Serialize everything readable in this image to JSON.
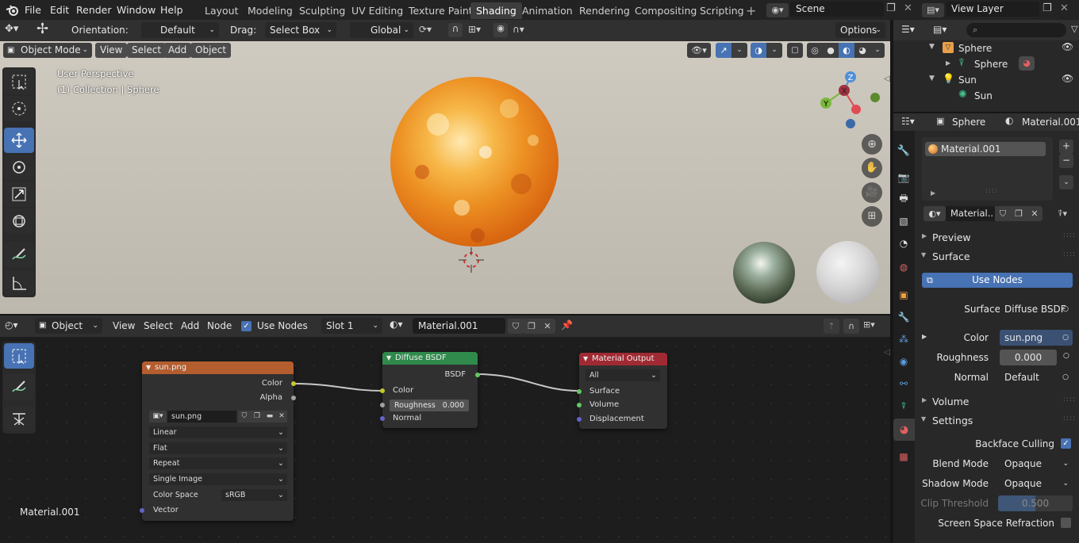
{
  "menus": [
    "File",
    "Edit",
    "Render",
    "Window",
    "Help"
  ],
  "workspaces": [
    {
      "label": "Layout"
    },
    {
      "label": "Modeling"
    },
    {
      "label": "Sculpting"
    },
    {
      "label": "UV Editing"
    },
    {
      "label": "Texture Paint"
    },
    {
      "label": "Shading",
      "active": true
    },
    {
      "label": "Animation"
    },
    {
      "label": "Rendering"
    },
    {
      "label": "Compositing"
    },
    {
      "label": "Scripting"
    }
  ],
  "scene": "Scene",
  "view_layer": "View Layer",
  "tool_header": {
    "orientation_label": "Orientation:",
    "orientation": "Default",
    "drag_label": "Drag:",
    "drag": "Select Box",
    "transform": "Global",
    "options": "Options"
  },
  "viewport": {
    "mode": "Object Mode",
    "menus": [
      "View",
      "Select",
      "Add",
      "Object"
    ],
    "overlay_line1": "User Perspective",
    "overlay_line2": "(1) Collection | Sphere",
    "gizmo": {
      "z": "Z",
      "y": "Y",
      "x": "X"
    }
  },
  "node_editor": {
    "type": "Object",
    "menus": [
      "View",
      "Select",
      "Add",
      "Node"
    ],
    "use_nodes": "Use Nodes",
    "slot": "Slot 1",
    "material": "Material.001",
    "bottom_label": "Material.001",
    "image_node": {
      "title": "sun.png",
      "out_color": "Color",
      "out_alpha": "Alpha",
      "image": "sun.png",
      "interp": "Linear",
      "proj": "Flat",
      "ext": "Repeat",
      "source": "Single Image",
      "cs_label": "Color Space",
      "cs_value": "sRGB",
      "in_vector": "Vector"
    },
    "bsdf_node": {
      "title": "Diffuse BSDF",
      "out": "BSDF",
      "in_color": "Color",
      "in_rough": "Roughness",
      "rough_val": "0.000",
      "in_normal": "Normal"
    },
    "output_node": {
      "title": "Material Output",
      "target": "All",
      "in_surface": "Surface",
      "in_volume": "Volume",
      "in_disp": "Displacement"
    }
  },
  "outliner": {
    "items": [
      {
        "label": "Sphere",
        "depth": 0
      },
      {
        "label": "Sphere",
        "depth": 1
      },
      {
        "label": "Sun",
        "depth": 0
      },
      {
        "label": "Sun",
        "depth": 1
      }
    ]
  },
  "properties": {
    "object": "Sphere",
    "material": "Material.001",
    "slot_item": "Material.001",
    "mat_field": "Material..",
    "preview": "Preview",
    "surface_panel": "Surface",
    "use_nodes": "Use Nodes",
    "surface_label": "Surface",
    "surface_value": "Diffuse BSDF",
    "color_label": "Color",
    "color_value": "sun.png",
    "rough_label": "Roughness",
    "rough_value": "0.000",
    "normal_label": "Normal",
    "normal_value": "Default",
    "volume_panel": "Volume",
    "settings_panel": "Settings",
    "backface": "Backface Culling",
    "blend_label": "Blend Mode",
    "blend_value": "Opaque",
    "shadow_label": "Shadow Mode",
    "shadow_value": "Opaque",
    "clip_label": "Clip Threshold",
    "clip_value": "0.500",
    "ssr": "Screen Space Refraction"
  },
  "colors": {
    "accent": "#4772b3",
    "image_header": "#b45d2f",
    "bsdf_header": "#2f8a4c",
    "output_header": "#a02a33"
  }
}
